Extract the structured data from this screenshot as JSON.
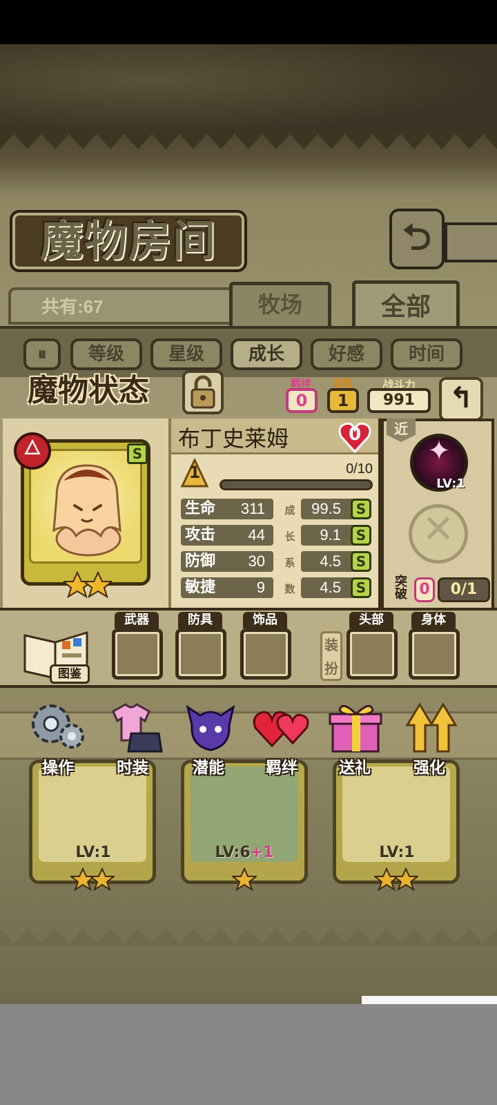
{
  "room": {
    "title": "魔物房间",
    "count_label": "共有:67",
    "tabs": [
      "牧场",
      "全部"
    ],
    "sort_buttons": [
      "等级",
      "星级",
      "成长",
      "好感",
      "时间"
    ]
  },
  "status": {
    "title": "魔物状态",
    "bond_label": "羁绊",
    "bond_value": "0",
    "potential_label": "潜能",
    "potential_value": "1",
    "power_label": "战斗力",
    "power_value": "991"
  },
  "monster": {
    "name": "布丁史莱姆",
    "rank": "S",
    "stars": 2,
    "favor": "0",
    "level": "1",
    "exp": "0/10",
    "exp_fraction": 0,
    "stats": [
      {
        "name": "生命",
        "value": "311",
        "growth": "99.5",
        "rank": "S"
      },
      {
        "name": "攻击",
        "value": "44",
        "growth": "9.1",
        "rank": "S"
      },
      {
        "name": "防御",
        "value": "30",
        "growth": "4.5",
        "rank": "S"
      },
      {
        "name": "敏捷",
        "value": "9",
        "growth": "4.5",
        "rank": "S"
      }
    ],
    "growth_chars": [
      "成",
      "长",
      "系",
      "数"
    ]
  },
  "skills": {
    "range": "近",
    "skill_level": "LV:1",
    "break_label": "突破",
    "break_value": "0",
    "break_progress": "0/1"
  },
  "equipment": {
    "atlas_label": "图鉴",
    "slots": [
      "武器",
      "防具",
      "饰品",
      "头部",
      "身体"
    ],
    "dress_label": "装扮"
  },
  "actions": [
    "操作",
    "时装",
    "潜能",
    "羁绊",
    "送礼",
    "强化"
  ],
  "background_cards": [
    {
      "level": "LV:1",
      "plus": ""
    },
    {
      "level": "LV:6",
      "plus": "+1"
    },
    {
      "level": "LV:1",
      "plus": ""
    }
  ],
  "colors": {
    "parchment": "#a19a74",
    "panel": "#e9dcb4",
    "bond_pink": "#e0408a",
    "rank_green": "#b8d24a"
  }
}
